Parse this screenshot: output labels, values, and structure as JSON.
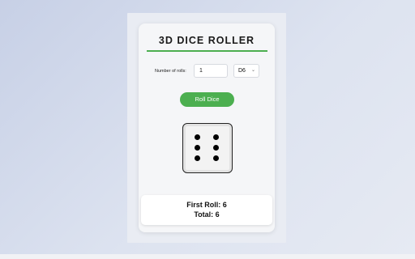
{
  "app": {
    "title": "3D DICE ROLLER"
  },
  "controls": {
    "rolls_label": "Number of rolls:",
    "rolls_value": "1",
    "die_type": "D6",
    "roll_button_label": "Roll Dice"
  },
  "die": {
    "face_value": 6
  },
  "results": {
    "first_roll": "First Roll: 6",
    "total": "Total: 6"
  },
  "colors": {
    "accent": "#4caf50",
    "background": "#d5dcec",
    "card": "#f5f6f8"
  }
}
